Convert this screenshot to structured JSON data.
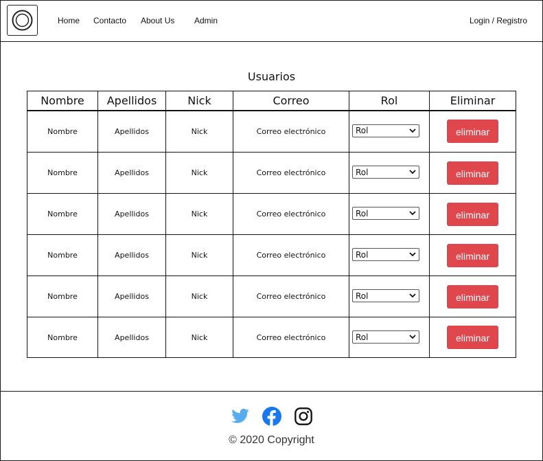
{
  "header": {
    "logo_icon": "camera-lens-icon",
    "nav": [
      "Home",
      "Contacto",
      "About Us",
      "Admin"
    ],
    "login": "Login / Registro"
  },
  "main": {
    "title": "Usuarios",
    "columns": [
      "Nombre",
      "Apellidos",
      "Nick",
      "Correo",
      "Rol",
      "Eliminar"
    ],
    "rows": [
      {
        "nombre": "Nombre",
        "apellidos": "Apellidos",
        "nick": "Nick",
        "correo": "Correo electrónico",
        "rol": "Rol",
        "eliminar": "eliminar"
      },
      {
        "nombre": "Nombre",
        "apellidos": "Apellidos",
        "nick": "Nick",
        "correo": "Correo electrónico",
        "rol": "Rol",
        "eliminar": "eliminar"
      },
      {
        "nombre": "Nombre",
        "apellidos": "Apellidos",
        "nick": "Nick",
        "correo": "Correo electrónico",
        "rol": "Rol",
        "eliminar": "eliminar"
      },
      {
        "nombre": "Nombre",
        "apellidos": "Apellidos",
        "nick": "Nick",
        "correo": "Correo electrónico",
        "rol": "Rol",
        "eliminar": "eliminar"
      },
      {
        "nombre": "Nombre",
        "apellidos": "Apellidos",
        "nick": "Nick",
        "correo": "Correo electrónico",
        "rol": "Rol",
        "eliminar": "eliminar"
      },
      {
        "nombre": "Nombre",
        "apellidos": "Apellidos",
        "nick": "Nick",
        "correo": "Correo electrónico",
        "rol": "Rol",
        "eliminar": "eliminar"
      }
    ]
  },
  "footer": {
    "social": [
      "twitter-icon",
      "facebook-icon",
      "instagram-icon"
    ],
    "copyright": "© 2020 Copyright"
  },
  "colors": {
    "delete_button": "#e0474c",
    "twitter": "#55acee",
    "facebook": "#1877f2",
    "instagram": "#111111"
  }
}
